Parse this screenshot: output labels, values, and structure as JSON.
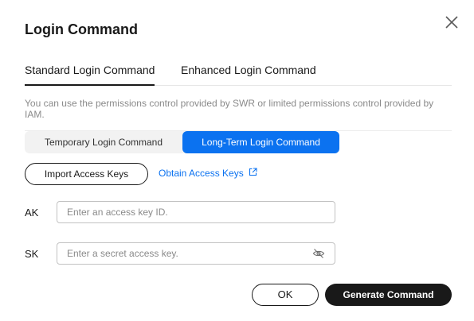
{
  "dialog": {
    "title": "Login Command",
    "close_icon": "close-icon"
  },
  "tabs": [
    {
      "label": "Standard Login Command",
      "active": true
    },
    {
      "label": "Enhanced Login Command",
      "active": false
    }
  ],
  "info_text": "You can use the permissions control provided by SWR or limited permissions control provided by IAM.",
  "segmented": [
    {
      "label": "Temporary Login Command",
      "active": false
    },
    {
      "label": "Long-Term Login Command",
      "active": true
    }
  ],
  "import_button": "Import Access Keys",
  "obtain_link": {
    "label": "Obtain Access Keys",
    "icon": "external-link-icon"
  },
  "fields": {
    "ak": {
      "label": "AK",
      "placeholder": "Enter an access key ID.",
      "value": ""
    },
    "sk": {
      "label": "SK",
      "placeholder": "Enter a secret access key.",
      "value": "",
      "icon": "eye-off-icon"
    }
  },
  "footer": {
    "ok_label": "OK",
    "generate_label": "Generate Command"
  },
  "colors": {
    "primary": "#0b72f0",
    "dark": "#191919",
    "muted_text": "#8a8a8a"
  }
}
